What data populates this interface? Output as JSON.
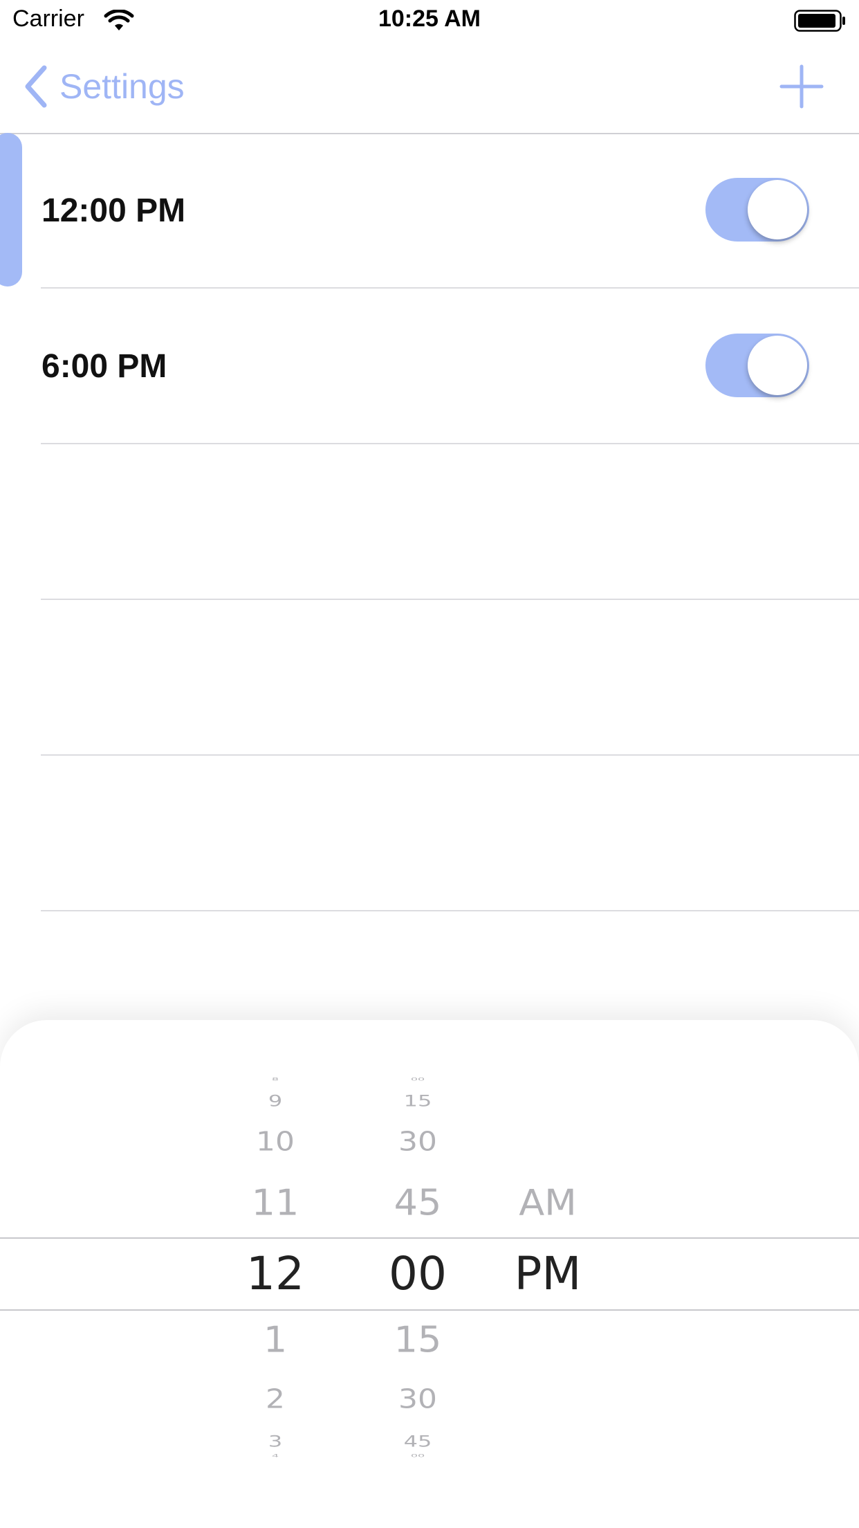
{
  "status_bar": {
    "carrier": "Carrier",
    "time": "10:25 AM"
  },
  "nav": {
    "back_label": "Settings"
  },
  "colors": {
    "accent": "#9fb5f5",
    "toggle_on": "#a3baf6",
    "divider": "#dcdce0"
  },
  "alarms": [
    {
      "time": "12:00 PM",
      "enabled": true
    },
    {
      "time": "6:00 PM",
      "enabled": true
    }
  ],
  "picker": {
    "hours": [
      "8",
      "9",
      "10",
      "11",
      "12",
      "1",
      "2",
      "3",
      "4"
    ],
    "minutes": [
      "00",
      "15",
      "30",
      "45",
      "00",
      "15",
      "30",
      "45",
      "00"
    ],
    "periods": [
      "AM",
      "PM"
    ],
    "selected": {
      "hour": "12",
      "minute": "00",
      "period": "PM"
    }
  }
}
